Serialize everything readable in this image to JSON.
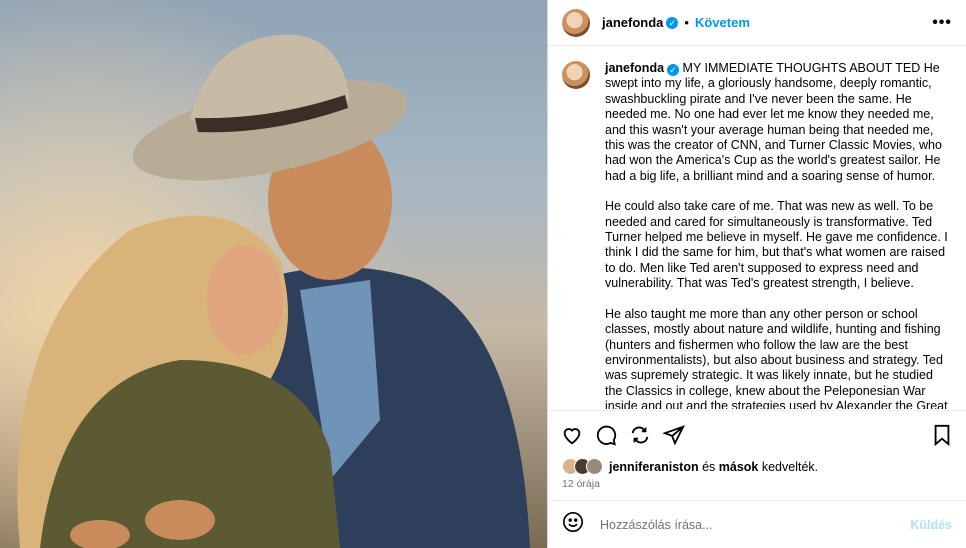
{
  "post": {
    "username": "janefonda",
    "verified_mark": "✓",
    "dot": "•",
    "follow_label": "Követem",
    "more_label": "•••",
    "caption_paragraphs": [
      "MY IMMEDIATE THOUGHTS ABOUT TED He swept into my life, a gloriously handsome, deeply romantic, swashbuckling pirate and I've never been the same. He needed me. No one had ever let me know they needed me, and this wasn't your average human being that needed me, this was the creator of CNN, and Turner Classic Movies, who had won the America's Cup as the world's greatest sailor. He had a big life, a brilliant mind and a soaring sense of humor.",
      "He could also take care of me. That was new as well. To be needed and cared for simultaneously is transformative. Ted Turner helped me believe in myself. He gave me confidence. I think I did the same for him, but that's what women are raised to do. Men like Ted aren't supposed to express need and vulnerability. That was Ted's greatest strength, I believe.",
      "He also taught me more than any other person or school classes, mostly about nature and wildlife, hunting and fishing (hunters and fishermen who follow the law are the best environmentalists), but also about business and strategy. Ted was supremely strategic. It was likely innate, but he studied the Classics in college, knew about the Peleponesian War inside and out and the strategies used by Alexander the Great and even"
    ],
    "likes": {
      "user": "jenniferaniston",
      "and": "és",
      "others": "mások",
      "suffix": "kedvelték."
    },
    "time_ago": "12 órája",
    "comment_placeholder": "Hozzászólás írása...",
    "send_label": "Küldés"
  },
  "icons": [
    "heart-icon",
    "comment-icon",
    "share-icon",
    "send-icon",
    "bookmark-icon",
    "emoji-icon"
  ]
}
